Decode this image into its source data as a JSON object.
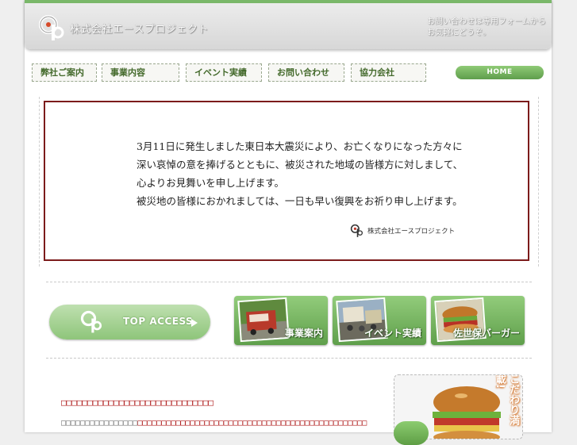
{
  "header": {
    "company_name": "株式会社エースプロジェクト",
    "note_line1": "お問い合わせは専用フォームから",
    "note_line2": "お気軽にどうぞ。"
  },
  "nav": {
    "items": [
      {
        "label": "弊社ご案内"
      },
      {
        "label": "事業内容"
      },
      {
        "label": "イベント実績"
      },
      {
        "label": "お問い合わせ"
      },
      {
        "label": "協力会社"
      }
    ],
    "home_label": "HOME"
  },
  "notice": {
    "lines": [
      "3月11日に発生しました東日本大震災により、お亡くなりになった方々に",
      "深い哀悼の意を捧げるとともに、被災された地域の皆様方に対しまして、",
      "心よりお見舞いを申し上げます。",
      "被災地の皆様におかれましては、一日も早い復興をお祈り申し上げます。"
    ],
    "signature": "株式会社エースプロジェクト"
  },
  "banners": {
    "top_access": "TOP ACCESS",
    "features": [
      {
        "label": "事業案内"
      },
      {
        "label": "イベント実績"
      },
      {
        "label": "佐世保バーガー"
      }
    ]
  },
  "promo": {
    "vertical_text": "こだわり満載!"
  },
  "content": {
    "garbled_title": "□□□□□□□□□□□□□□□□□□□□□□□□□□□□□",
    "garbled_line_gray": "□□□□□□□□□□□□□□□□",
    "garbled_line_red": "□□□□□□□□□□□□□□□□□□□□□□□□□□□□□□□□□□□□□□□□□□□□□□□□"
  },
  "colors": {
    "accent_green": "#7ab86a",
    "notice_border": "#7c1b1b",
    "link_red": "#b01e1e"
  }
}
